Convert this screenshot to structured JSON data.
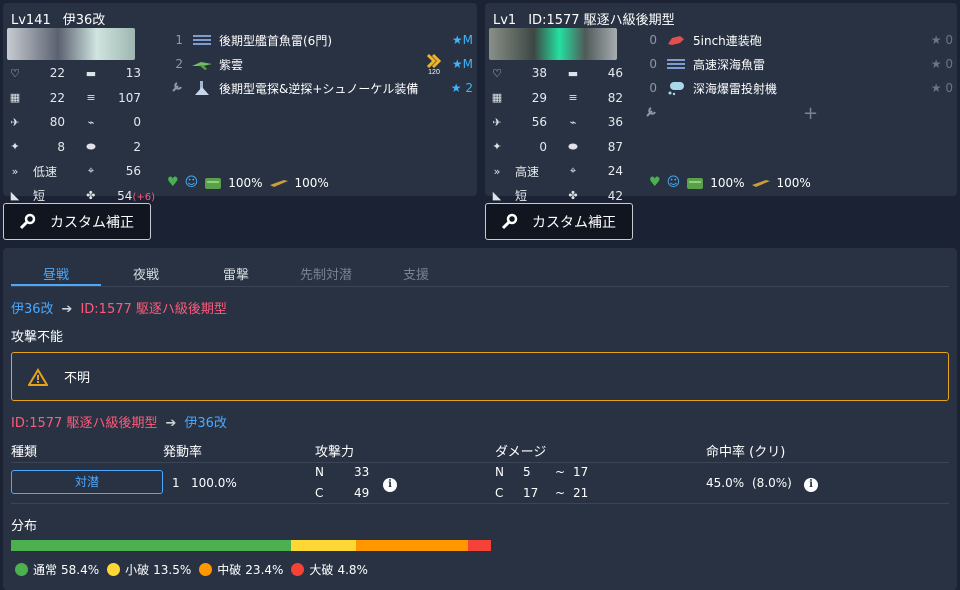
{
  "ship1": {
    "level": "Lv141",
    "name": "伊36改",
    "stats": [
      [
        "22",
        "13"
      ],
      [
        "22",
        "107"
      ],
      [
        "80",
        "0"
      ],
      [
        "8",
        "2"
      ],
      [
        "低速",
        "56"
      ],
      [
        "短",
        "54"
      ]
    ],
    "luck_bonus": "(+6)",
    "equipment": [
      {
        "count": "1",
        "name": "後期型艦首魚雷(6門)",
        "level": "★M",
        "icon": "torpedo-icon"
      },
      {
        "count": "2",
        "name": "紫雲",
        "level": "★M",
        "proficiency_label": "120",
        "icon": "seaplane-icon"
      },
      {
        "count": "",
        "name": "後期型電探&逆探+シュノーケル装備",
        "level": "★ 2",
        "icon": "radar-icon"
      }
    ],
    "morale": "100%",
    "fuel": "100%",
    "ammo": "100%"
  },
  "ship2": {
    "level": "Lv1",
    "name": "ID:1577 駆逐ハ級後期型",
    "stats": [
      [
        "38",
        "46"
      ],
      [
        "29",
        "82"
      ],
      [
        "56",
        "36"
      ],
      [
        "0",
        "87"
      ],
      [
        "高速",
        "24"
      ],
      [
        "短",
        "42"
      ]
    ],
    "equipment": [
      {
        "count": "0",
        "name": "5inch連装砲",
        "level": "★ 0",
        "icon": "gun-icon"
      },
      {
        "count": "0",
        "name": "高速深海魚雷",
        "level": "★ 0",
        "icon": "torpedo-icon"
      },
      {
        "count": "0",
        "name": "深海爆雷投射機",
        "level": "★ 0",
        "icon": "depth-charge-icon"
      }
    ],
    "fuel": "100%",
    "ammo": "100%"
  },
  "custom_button": "カスタム補正",
  "tabs": [
    "昼戦",
    "夜戦",
    "雷撃",
    "先制対潜",
    "支援"
  ],
  "active_tab": 0,
  "attack1": {
    "from": "伊36改",
    "to": "ID:1577 駆逐ハ級後期型",
    "result": "攻撃不能",
    "warning": "不明"
  },
  "attack2": {
    "from": "ID:1577 駆逐ハ級後期型",
    "to": "伊36改",
    "headers": [
      "種類",
      "発動率",
      "攻撃力",
      "ダメージ",
      "命中率 (クリ)"
    ],
    "row": {
      "type": "対潜",
      "multiplier": "1",
      "rate": "100.0%",
      "power_n_label": "N",
      "power_n": "33",
      "power_c_label": "C",
      "power_c": "49",
      "dmg_n_label": "N",
      "dmg_n_min": "5",
      "dmg_n_max": "17",
      "dmg_c_label": "C",
      "dmg_c_min": "17",
      "dmg_c_max": "21",
      "tilde": "~",
      "hit": "45.0%",
      "crit": "(8.0%)"
    }
  },
  "distribution": {
    "title": "分布",
    "items": [
      {
        "label": "通常",
        "value": "58.4%",
        "fraction": 58.4,
        "color": "#4caf50"
      },
      {
        "label": "小破",
        "value": "13.5%",
        "fraction": 13.5,
        "color": "#fdd835"
      },
      {
        "label": "中破",
        "value": "23.4%",
        "fraction": 23.4,
        "color": "#ff9800"
      },
      {
        "label": "大破",
        "value": "4.8%",
        "fraction": 4.8,
        "color": "#f44336"
      }
    ]
  }
}
